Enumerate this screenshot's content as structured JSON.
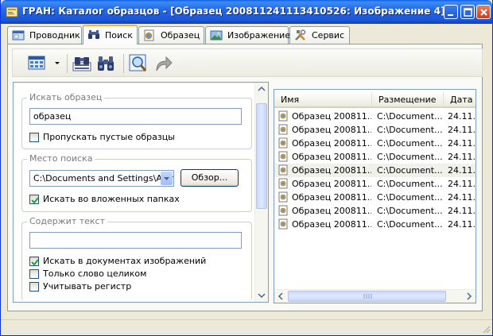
{
  "window": {
    "title": "ГРАН: Каталог образцов - [Образец 200811241113410526: Изображение 4]"
  },
  "tabs": [
    {
      "label": "Проводник",
      "icon": "explorer-icon"
    },
    {
      "label": "Поиск",
      "icon": "binoculars-icon",
      "active": true
    },
    {
      "label": "Образец",
      "icon": "sample-icon"
    },
    {
      "label": "Изображение",
      "icon": "image-icon"
    },
    {
      "label": "Сервис",
      "icon": "tools-icon"
    }
  ],
  "search": {
    "sample_group_title": "Искать образец",
    "sample_value": "образец",
    "skip_empty_label": "Пропускать пустые образцы",
    "skip_empty_checked": false,
    "location_group_title": "Место поиска",
    "location_value": "C:\\Documents and Settings\\Admin",
    "browse_label": "Обзор...",
    "subfolders_label": "Искать во вложенных папках",
    "subfolders_checked": true,
    "text_group_title": "Содержит текст",
    "text_value": "",
    "in_image_docs_label": "Искать в документах изображений",
    "in_image_docs_checked": true,
    "whole_word_label": "Только слово целиком",
    "whole_word_checked": false,
    "match_case_label": "Учитывать регистр",
    "match_case_checked": false
  },
  "results": {
    "columns": [
      "Имя",
      "Размещение",
      "Дата"
    ],
    "rows": [
      {
        "name": "Образец 200811...",
        "location": "C:\\Document...",
        "date": "24.11."
      },
      {
        "name": "Образец 200811...",
        "location": "C:\\Document...",
        "date": "24.11."
      },
      {
        "name": "Образец 200811...",
        "location": "C:\\Document...",
        "date": "24.11."
      },
      {
        "name": "Образец 200811...",
        "location": "C:\\Document...",
        "date": "24.11."
      },
      {
        "name": "Образец 200811...",
        "location": "C:\\Document...",
        "date": "24.11.",
        "selected": true
      },
      {
        "name": "Образец 200811...",
        "location": "C:\\Document...",
        "date": "24.11."
      },
      {
        "name": "Образец 200811...",
        "location": "C:\\Document...",
        "date": "24.11."
      },
      {
        "name": "Образец 200811...",
        "location": "C:\\Document...",
        "date": "24.11."
      },
      {
        "name": "Образец 200811...",
        "location": "C:\\Document...",
        "date": "24.11."
      }
    ]
  },
  "colors": {
    "titlebar": "#2569e3",
    "active_tab_accent": "#f4b436",
    "border": "#7f9db9"
  }
}
